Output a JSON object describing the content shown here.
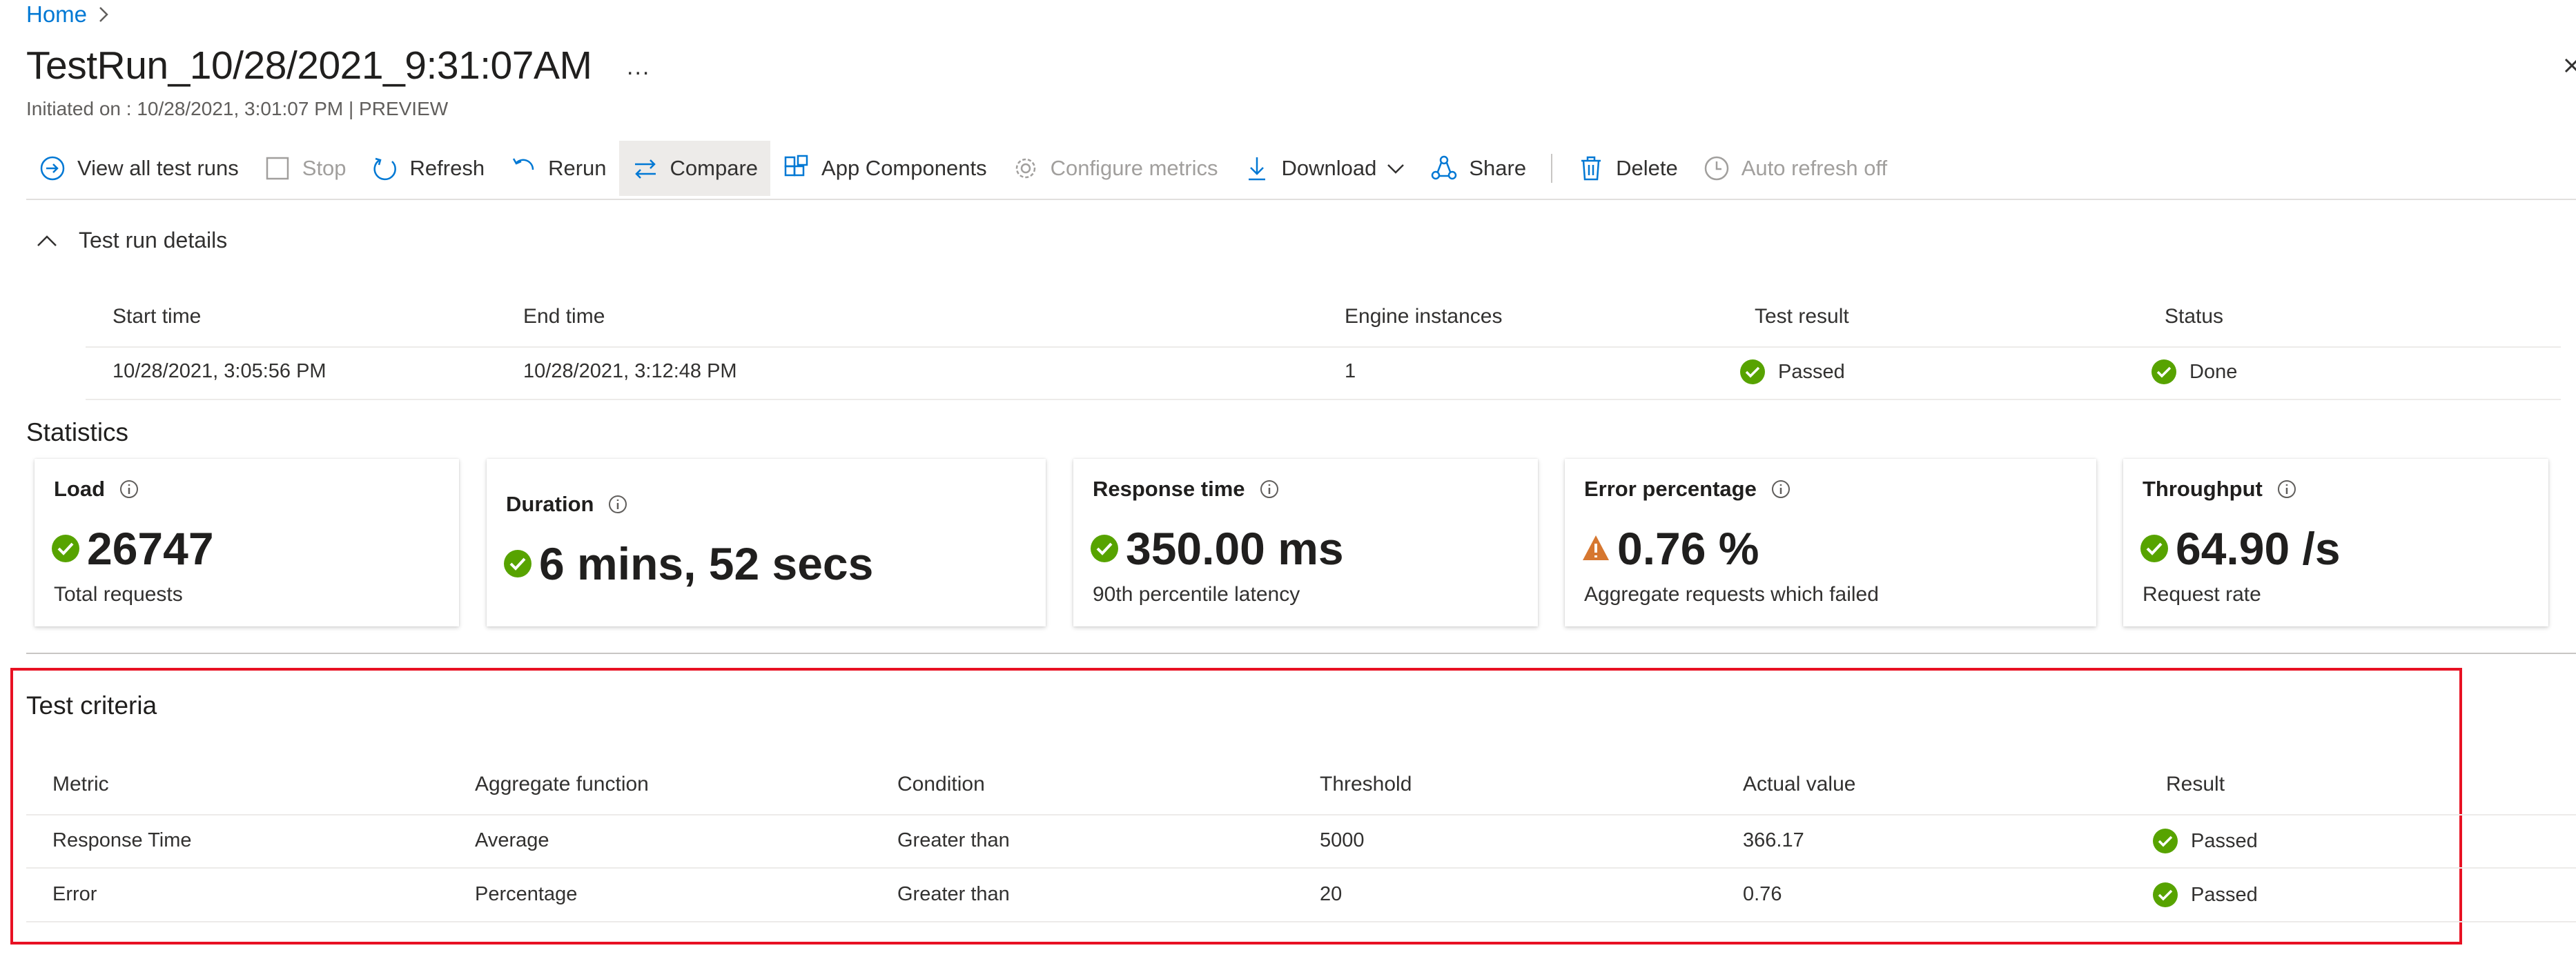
{
  "breadcrumb": {
    "home": "Home",
    "separator": ">"
  },
  "page": {
    "title": "TestRun_10/28/2021_9:31:07AM",
    "more": "...",
    "subtitle": "Initiated on : 10/28/2021, 3:01:07 PM | PREVIEW"
  },
  "toolbar": {
    "view_all": "View all test runs",
    "stop": "Stop",
    "refresh": "Refresh",
    "rerun": "Rerun",
    "compare": "Compare",
    "app_components": "App Components",
    "configure_metrics": "Configure metrics",
    "download": "Download",
    "share": "Share",
    "delete": "Delete",
    "auto_refresh": "Auto refresh off"
  },
  "run_details": {
    "section_label": "Test run details",
    "headers": [
      "Start time",
      "End time",
      "Engine instances",
      "Test result",
      "Status"
    ],
    "row": [
      "10/28/2021, 3:05:56 PM",
      "10/28/2021, 3:12:48 PM",
      "1",
      "Passed",
      "Done"
    ]
  },
  "statistics": {
    "title": "Statistics",
    "cards": [
      {
        "label": "Load",
        "value": "26747",
        "sub": "Total requests",
        "status": "ok"
      },
      {
        "label": "Duration",
        "value": "6 mins, 52 secs",
        "sub": "",
        "status": "ok"
      },
      {
        "label": "Response time",
        "value": "350.00 ms",
        "sub": "90th percentile latency",
        "status": "ok"
      },
      {
        "label": "Error percentage",
        "value": "0.76 %",
        "sub": "Aggregate requests which failed",
        "status": "warning"
      },
      {
        "label": "Throughput",
        "value": "64.90 /s",
        "sub": "Request rate",
        "status": "ok"
      }
    ]
  },
  "criteria": {
    "title": "Test criteria",
    "headers": [
      "Metric",
      "Aggregate function",
      "Condition",
      "Threshold",
      "Actual value",
      "Result"
    ],
    "rows": [
      [
        "Response Time",
        "Average",
        "Greater than",
        "5000",
        "366.17",
        "Passed"
      ],
      [
        "Error",
        "Percentage",
        "Greater than",
        "20",
        "0.76",
        "Passed"
      ]
    ]
  },
  "colors": {
    "accent": "#0078d4",
    "success": "#57a300",
    "warning": "#d67730",
    "highlight_border": "#e81123"
  }
}
